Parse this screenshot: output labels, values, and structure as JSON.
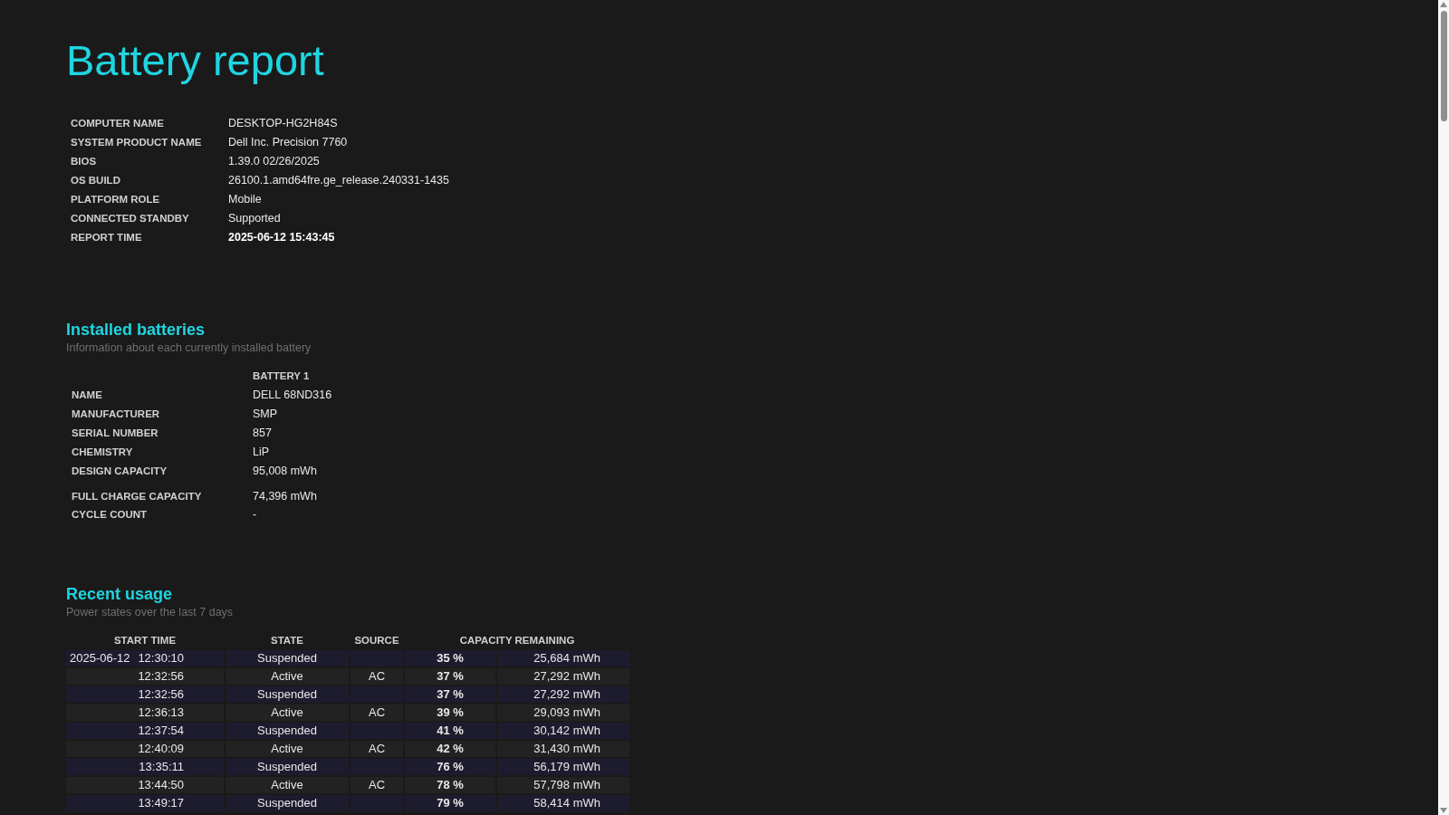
{
  "title": "Battery report",
  "system_info": [
    {
      "label": "COMPUTER NAME",
      "value": "DESKTOP-HG2H84S",
      "bold": false
    },
    {
      "label": "SYSTEM PRODUCT NAME",
      "value": "Dell Inc. Precision 7760",
      "bold": false
    },
    {
      "label": "BIOS",
      "value": "1.39.0 02/26/2025",
      "bold": false
    },
    {
      "label": "OS BUILD",
      "value": "26100.1.amd64fre.ge_release.240331-1435",
      "bold": false
    },
    {
      "label": "PLATFORM ROLE",
      "value": "Mobile",
      "bold": false
    },
    {
      "label": "CONNECTED STANDBY",
      "value": "Supported",
      "bold": false
    },
    {
      "label": "REPORT TIME",
      "value": "2025-06-12  15:43:45",
      "bold": true
    }
  ],
  "installed_batteries": {
    "heading": "Installed batteries",
    "subtitle": "Information about each currently installed battery",
    "column": "BATTERY 1",
    "rows": [
      {
        "label": "NAME",
        "value": "DELL 68ND316"
      },
      {
        "label": "MANUFACTURER",
        "value": "SMP"
      },
      {
        "label": "SERIAL NUMBER",
        "value": "857"
      },
      {
        "label": "CHEMISTRY",
        "value": "LiP"
      },
      {
        "label": "DESIGN CAPACITY",
        "value": "95,008 mWh"
      },
      {
        "label": "FULL CHARGE CAPACITY",
        "value": "74,396 mWh"
      },
      {
        "label": "CYCLE COUNT",
        "value": "-"
      }
    ]
  },
  "recent_usage": {
    "heading": "Recent usage",
    "subtitle": "Power states over the last 7 days",
    "columns": [
      "START TIME",
      "STATE",
      "SOURCE",
      "CAPACITY REMAINING"
    ],
    "rows": [
      {
        "date": "2025-06-12",
        "time": "12:30:10",
        "state": "Suspended",
        "source": "",
        "percent": "35 %",
        "energy": "25,684 mWh"
      },
      {
        "date": "",
        "time": "12:32:56",
        "state": "Active",
        "source": "AC",
        "percent": "37 %",
        "energy": "27,292 mWh"
      },
      {
        "date": "",
        "time": "12:32:56",
        "state": "Suspended",
        "source": "",
        "percent": "37 %",
        "energy": "27,292 mWh"
      },
      {
        "date": "",
        "time": "12:36:13",
        "state": "Active",
        "source": "AC",
        "percent": "39 %",
        "energy": "29,093 mWh"
      },
      {
        "date": "",
        "time": "12:37:54",
        "state": "Suspended",
        "source": "",
        "percent": "41 %",
        "energy": "30,142 mWh"
      },
      {
        "date": "",
        "time": "12:40:09",
        "state": "Active",
        "source": "AC",
        "percent": "42 %",
        "energy": "31,430 mWh"
      },
      {
        "date": "",
        "time": "13:35:11",
        "state": "Suspended",
        "source": "",
        "percent": "76 %",
        "energy": "56,179 mWh"
      },
      {
        "date": "",
        "time": "13:44:50",
        "state": "Active",
        "source": "AC",
        "percent": "78 %",
        "energy": "57,798 mWh"
      },
      {
        "date": "",
        "time": "13:49:17",
        "state": "Suspended",
        "source": "",
        "percent": "79 %",
        "energy": "58,414 mWh"
      }
    ]
  }
}
